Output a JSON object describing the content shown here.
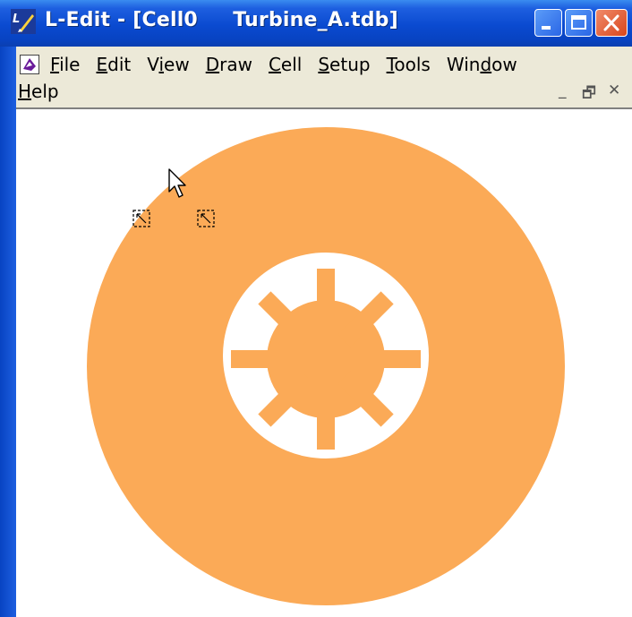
{
  "window": {
    "title": "L-Edit - [Cell0     Turbine_A.tdb]",
    "app_icon": "l-edit-app-icon",
    "title_buttons": [
      "minimize-icon",
      "maximize-icon",
      "close-icon"
    ]
  },
  "menubar": {
    "doc_icon": "document-icon",
    "items": [
      {
        "label": "File",
        "accel": "F"
      },
      {
        "label": "Edit",
        "accel": "E"
      },
      {
        "label": "View",
        "accel": "i"
      },
      {
        "label": "Draw",
        "accel": "D"
      },
      {
        "label": "Cell",
        "accel": "C"
      },
      {
        "label": "Setup",
        "accel": "S"
      },
      {
        "label": "Tools",
        "accel": "T"
      },
      {
        "label": "Window",
        "accel": "d"
      },
      {
        "label": "Help",
        "accel": "H"
      }
    ],
    "mdi_controls": [
      "_",
      "🗗",
      "✕"
    ]
  },
  "canvas": {
    "layout_color": "#fbaa57",
    "background": "#ffffff",
    "shape": "turbine-disc-with-eight-spoke-hub"
  },
  "colors": {
    "titlebar": "#0a4ad0",
    "menubar": "#ece9d8",
    "close_button": "#d9471c"
  }
}
